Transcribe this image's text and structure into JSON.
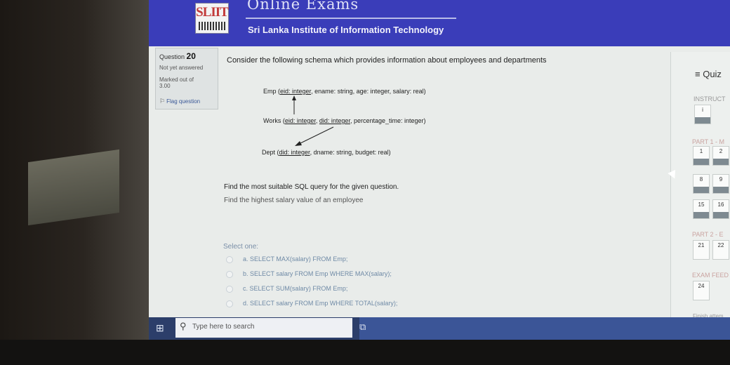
{
  "banner": {
    "logo_text": "SLIIT",
    "site_title": "Online Exams",
    "institute": "Sri Lanka Institute of Information Technology"
  },
  "question_info": {
    "label": "Question",
    "number": "20",
    "status": "Not yet answered",
    "marked_label": "Marked out of",
    "marks": "3.00",
    "flag_label": "Flag question"
  },
  "question": {
    "text": "Consider the following schema which provides information about employees and departments",
    "schema": {
      "emp": {
        "name": "Emp",
        "key": "eid: integer",
        "rest": ", ename: string, age: integer, salary: real)"
      },
      "works": {
        "name": "Works",
        "key1": "eid: integer",
        "key2": "did: integer",
        "rest": ", percentage_time: integer)"
      },
      "dept": {
        "name": "Dept",
        "key": "did: integer",
        "rest": ", dname: string, budget: real)"
      }
    },
    "prompt": "Find the most suitable SQL query for the given question.",
    "sub_prompt": "Find the highest salary value of an employee",
    "select_label": "Select one:",
    "options": [
      "a. SELECT MAX(salary) FROM Emp;",
      "b. SELECT salary FROM Emp WHERE MAX(salary);",
      "c. SELECT SUM(salary) FROM Emp;",
      "d. SELECT salary FROM Emp WHERE TOTAL(salary);"
    ]
  },
  "quiz_nav": {
    "title": "Quiz",
    "instructions_label": "INSTRUCT",
    "instructions_buttons": [
      "i"
    ],
    "part1_label": "PART 1 - M",
    "part1_buttons": [
      "1",
      "2",
      "8",
      "9",
      "15",
      "16"
    ],
    "part2_label": "PART 2 - E",
    "part2_buttons": [
      "21",
      "22"
    ],
    "feedback_label": "EXAM FEED",
    "feedback_buttons": [
      "24"
    ],
    "finish_label": "Finish attem"
  },
  "taskbar": {
    "search_placeholder": "Type here to search"
  }
}
